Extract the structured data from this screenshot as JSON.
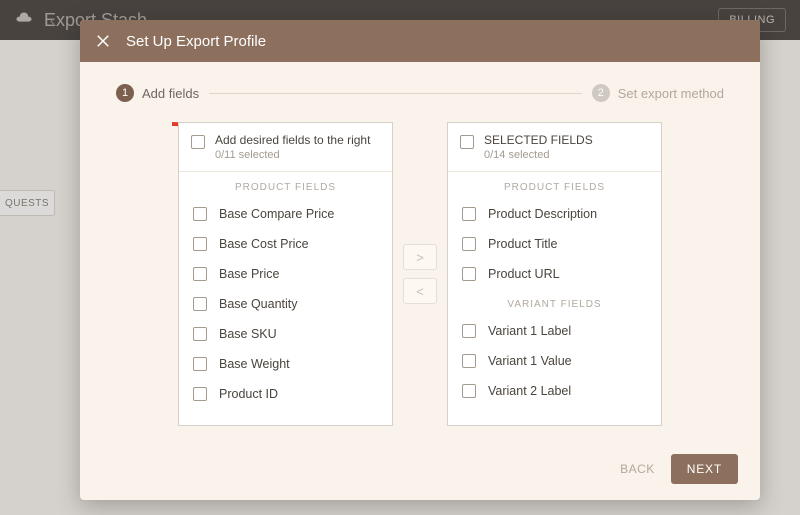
{
  "app": {
    "name": "Export Stash",
    "billing_btn": "BILLING",
    "bg_chip": "QUESTS"
  },
  "modal": {
    "title": "Set Up Export Profile",
    "steps": [
      {
        "num": "1",
        "label": "Add fields"
      },
      {
        "num": "2",
        "label": "Set export method"
      }
    ],
    "left_panel": {
      "title": "Add desired fields to the right",
      "subtitle": "0/11 selected",
      "groups": [
        {
          "label": "PRODUCT FIELDS",
          "items": [
            "Base Compare Price",
            "Base Cost Price",
            "Base Price",
            "Base Quantity",
            "Base SKU",
            "Base Weight",
            "Product ID"
          ]
        }
      ]
    },
    "right_panel": {
      "title": "SELECTED FIELDS",
      "subtitle": "0/14 selected",
      "groups": [
        {
          "label": "PRODUCT FIELDS",
          "items": [
            "Product Description",
            "Product Title",
            "Product URL"
          ]
        },
        {
          "label": "VARIANT FIELDS",
          "items": [
            "Variant 1 Label",
            "Variant 1 Value",
            "Variant 2 Label"
          ]
        }
      ]
    },
    "move_right": ">",
    "move_left": "<",
    "back": "BACK",
    "next": "NEXT"
  }
}
